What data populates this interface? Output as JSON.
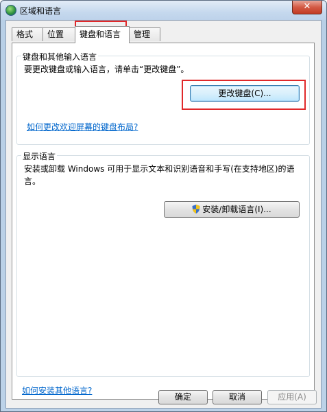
{
  "window": {
    "title": "区域和语言",
    "close": "✕"
  },
  "tabs": [
    {
      "label": "格式"
    },
    {
      "label": "位置"
    },
    {
      "label": "键盘和语言"
    },
    {
      "label": "管理"
    }
  ],
  "keyboard_group": {
    "label": "键盘和其他输入语言",
    "description": "要更改键盘或输入语言，请单击“更改键盘”。",
    "change_button": "更改键盘(C)...",
    "welcome_link": "如何更改欢迎屏幕的键盘布局?"
  },
  "display_group": {
    "label": "显示语言",
    "description_line1": "安装或卸载 Windows 可用于显示文本和识别语音和手写(在支持地区)的语",
    "description_line2": "言。",
    "install_button": "安装/卸载语言(I)..."
  },
  "footer": {
    "install_link": "如何安装其他语言?",
    "ok": "确定",
    "cancel": "取消",
    "apply": "应用(A)"
  },
  "colors": {
    "highlight": "#e0282a",
    "link": "#0066cc"
  }
}
